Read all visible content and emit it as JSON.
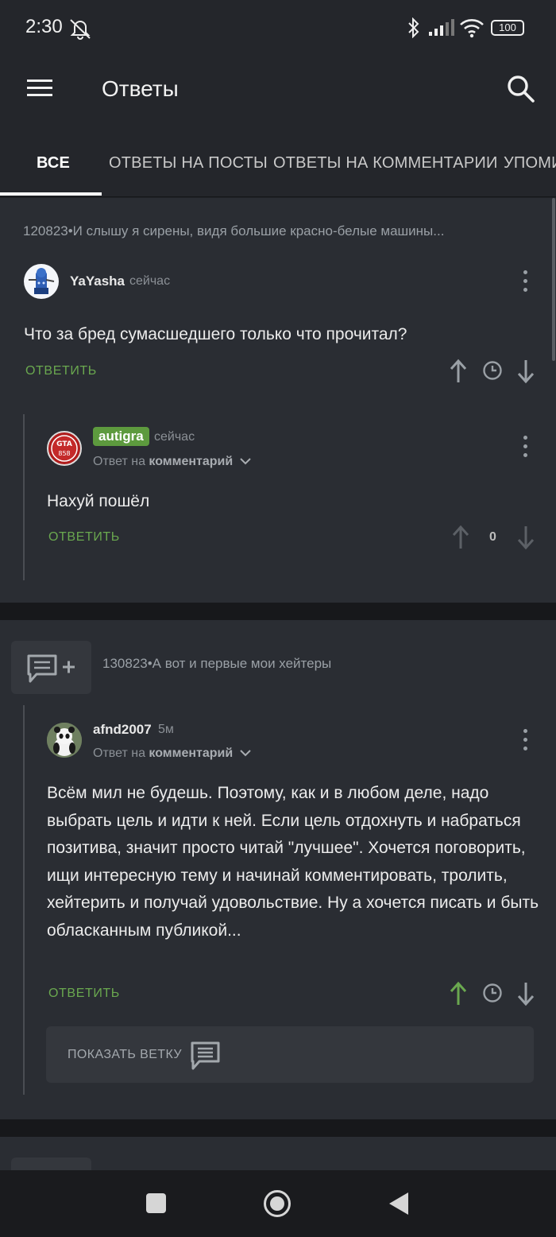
{
  "status_bar": {
    "time": "2:30",
    "battery": "100",
    "icons": [
      "alarm-off-icon",
      "bluetooth-icon",
      "signal-icon",
      "wifi-icon",
      "battery-icon"
    ]
  },
  "app_bar": {
    "title": "Ответы",
    "menu_icon": "hamburger-menu-icon",
    "search_icon": "search-icon"
  },
  "tabs": [
    {
      "label": "ВСЕ",
      "active": true
    },
    {
      "label": "ОТВЕТЫ НА ПОСТЫ",
      "active": false
    },
    {
      "label": "ОТВЕТЫ НА КОММЕНТАРИИ",
      "active": false
    },
    {
      "label": "УПОМИ",
      "active": false
    }
  ],
  "feed": [
    {
      "post_title": "120823•И слышу я сирены, видя большие красно-белые машины...",
      "comment": {
        "author": "YaYasha",
        "time": "сейчас",
        "text": "Что за бред сумасшедшего только что прочитал?",
        "reply_label": "ОТВЕТИТЬ"
      },
      "reply": {
        "author": "autigra",
        "time": "сейчас",
        "reply_to_prefix": "Ответ на",
        "reply_to_target": "комментарий",
        "text": "Нахуй пошёл",
        "reply_label": "ОТВЕТИТЬ",
        "rating": "0"
      }
    },
    {
      "post_title": "130823•А вот и первые мои хейтеры",
      "reply": {
        "author": "afnd2007",
        "time": "5м",
        "reply_to_prefix": "Ответ на",
        "reply_to_target": "комментарий",
        "text": "Всём мил не будешь. Поэтому, как и в любом деле, надо выбрать цель и идти к ней. Если цель отдохнуть и набраться позитива, значит просто читай \"лучшее\". Хочется поговорить, ищи интересную тему и начинай комментировать, тролить, хейтерить и получай удовольствие. Ну а хочется писать и быть обласканным публикой...",
        "reply_label": "ОТВЕТИТЬ",
        "show_thread_label": "ПОКАЗАТЬ ВЕТКУ"
      }
    }
  ],
  "colors": {
    "accent_green": "#6aa84f",
    "badge_green": "#5d9a3e",
    "background": "#202226",
    "card": "#2a2d33"
  },
  "nav_bar": {
    "icons": [
      "recents-square-icon",
      "home-circle-icon",
      "back-triangle-icon"
    ]
  }
}
